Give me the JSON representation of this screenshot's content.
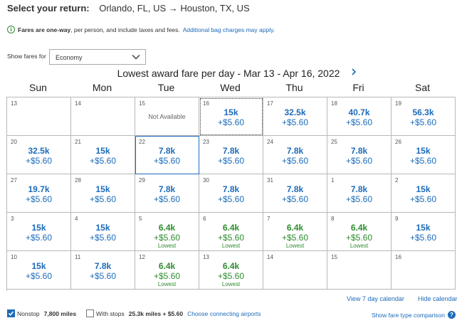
{
  "header": {
    "label": "Select your return:",
    "route": "Orlando, FL, US → Houston, TX, US"
  },
  "notice": {
    "bold": "Fares are one-way",
    "text": ", per person, and include taxes and fees.",
    "link": "Additional bag charges may apply."
  },
  "fares_for": {
    "label": "Show fares for",
    "selected": "Economy"
  },
  "calendar": {
    "title": "Lowest award fare per day - Mar 13 - Apr 16, 2022",
    "days_of_week": [
      "Sun",
      "Mon",
      "Tue",
      "Wed",
      "Thu",
      "Fri",
      "Sat"
    ],
    "weeks": [
      [
        {
          "day": "13"
        },
        {
          "day": "14"
        },
        {
          "day": "15",
          "status": "Not Available"
        },
        {
          "day": "16",
          "miles": "15k",
          "tax": "+$5.60"
        },
        {
          "day": "17",
          "miles": "32.5k",
          "tax": "+$5.60"
        },
        {
          "day": "18",
          "miles": "40.7k",
          "tax": "+$5.60"
        },
        {
          "day": "19",
          "miles": "56.3k",
          "tax": "+$5.60"
        }
      ],
      [
        {
          "day": "20",
          "miles": "32.5k",
          "tax": "+$5.60"
        },
        {
          "day": "21",
          "miles": "15k",
          "tax": "+$5.60"
        },
        {
          "day": "22",
          "miles": "7.8k",
          "tax": "+$5.60"
        },
        {
          "day": "23",
          "miles": "7.8k",
          "tax": "+$5.60"
        },
        {
          "day": "24",
          "miles": "7.8k",
          "tax": "+$5.60"
        },
        {
          "day": "25",
          "miles": "7.8k",
          "tax": "+$5.60"
        },
        {
          "day": "26",
          "miles": "15k",
          "tax": "+$5.60"
        }
      ],
      [
        {
          "day": "27",
          "miles": "19.7k",
          "tax": "+$5.60"
        },
        {
          "day": "28",
          "miles": "15k",
          "tax": "+$5.60"
        },
        {
          "day": "29",
          "miles": "7.8k",
          "tax": "+$5.60"
        },
        {
          "day": "30",
          "miles": "7.8k",
          "tax": "+$5.60"
        },
        {
          "day": "31",
          "miles": "7.8k",
          "tax": "+$5.60"
        },
        {
          "day": "1",
          "miles": "7.8k",
          "tax": "+$5.60"
        },
        {
          "day": "2",
          "miles": "15k",
          "tax": "+$5.60"
        }
      ],
      [
        {
          "day": "3",
          "miles": "15k",
          "tax": "+$5.60"
        },
        {
          "day": "4",
          "miles": "15k",
          "tax": "+$5.60"
        },
        {
          "day": "5",
          "miles": "6.4k",
          "tax": "+$5.60",
          "lowest": "Lowest"
        },
        {
          "day": "6",
          "miles": "6.4k",
          "tax": "+$5.60",
          "lowest": "Lowest"
        },
        {
          "day": "7",
          "miles": "6.4k",
          "tax": "+$5.60",
          "lowest": "Lowest"
        },
        {
          "day": "8",
          "miles": "6.4k",
          "tax": "+$5.60",
          "lowest": "Lowest"
        },
        {
          "day": "9",
          "miles": "15k",
          "tax": "+$5.60"
        }
      ],
      [
        {
          "day": "10",
          "miles": "15k",
          "tax": "+$5.60"
        },
        {
          "day": "11",
          "miles": "7.8k",
          "tax": "+$5.60"
        },
        {
          "day": "12",
          "miles": "6.4k",
          "tax": "+$5.60",
          "lowest": "Lowest"
        },
        {
          "day": "13",
          "miles": "6.4k",
          "tax": "+$5.60",
          "lowest": "Lowest"
        },
        {
          "day": "14"
        },
        {
          "day": "15"
        },
        {
          "day": "16"
        }
      ]
    ],
    "selected_cell": "22",
    "focused_cell": "16",
    "view7_label": "View 7 day calendar",
    "hide_label": "Hide calendar"
  },
  "footer": {
    "nonstop_label": "Nonstop",
    "nonstop_value": "7,800 miles",
    "nonstop_checked": true,
    "stops_label": "With stops",
    "stops_value": "25.3k miles + $5.60",
    "stops_checked": false,
    "connecting_link": "Choose connecting airports",
    "comparison_link": "Show fare type comparison"
  },
  "colors": {
    "link": "#1c6bba",
    "lowest": "#2e8b2e"
  },
  "icons": [
    "info-icon",
    "chevron-down-icon",
    "chevron-right-icon",
    "checkbox-checked-icon",
    "question-icon"
  ]
}
